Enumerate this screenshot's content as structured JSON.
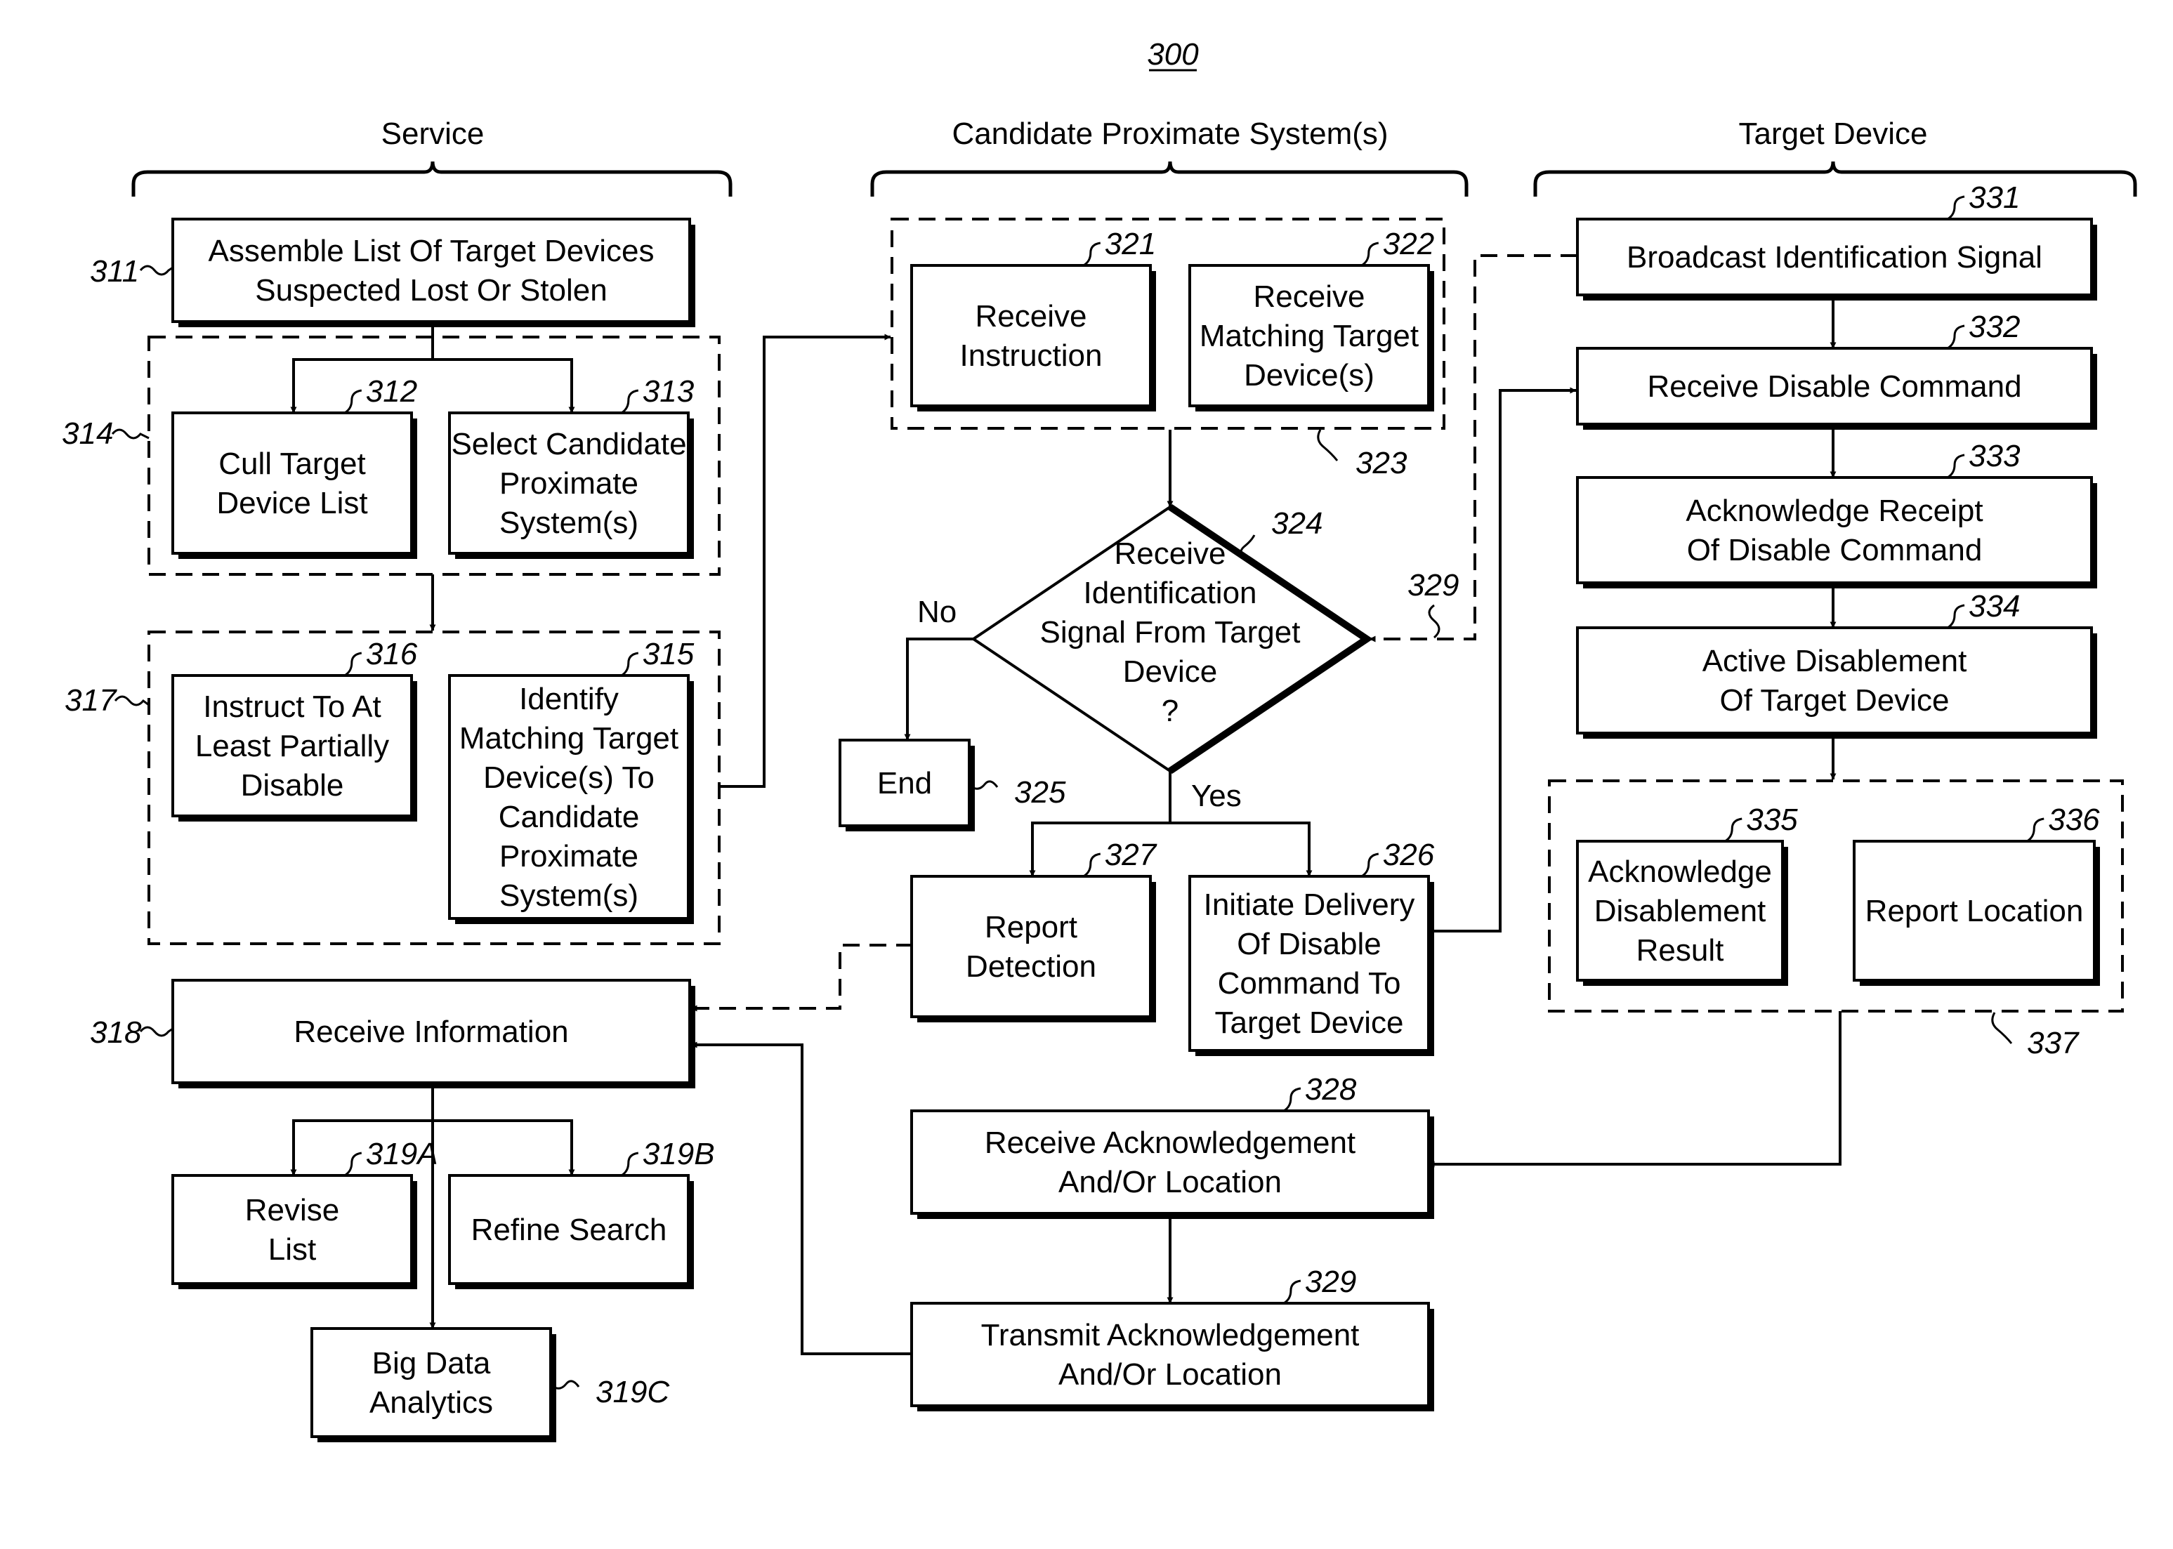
{
  "figure": {
    "number": "300"
  },
  "lanes": [
    {
      "id": "service",
      "title": "Service"
    },
    {
      "id": "candidate",
      "title": "Candidate Proximate System(s)"
    },
    {
      "id": "target",
      "title": "Target Device"
    }
  ],
  "nodes": {
    "n311": {
      "ref": "311",
      "lines": [
        "Assemble List Of Target Devices",
        "Suspected Lost Or Stolen"
      ]
    },
    "n312": {
      "ref": "312",
      "lines": [
        "Cull Target",
        "Device List"
      ]
    },
    "n313": {
      "ref": "313",
      "lines": [
        "Select Candidate",
        "Proximate",
        "System(s)"
      ]
    },
    "g314": {
      "ref": "314"
    },
    "n315": {
      "ref": "315",
      "lines": [
        "Identify",
        "Matching Target",
        "Device(s) To",
        "Candidate",
        "Proximate",
        "System(s)"
      ]
    },
    "n316": {
      "ref": "316",
      "lines": [
        "Instruct To At",
        "Least Partially",
        "Disable"
      ]
    },
    "g317": {
      "ref": "317"
    },
    "n318": {
      "ref": "318",
      "lines": [
        "Receive Information"
      ]
    },
    "n319A": {
      "ref": "319A",
      "lines": [
        "Revise",
        "List"
      ]
    },
    "n319B": {
      "ref": "319B",
      "lines": [
        "Refine Search"
      ]
    },
    "n319C": {
      "ref": "319C",
      "lines": [
        "Big Data",
        "Analytics"
      ]
    },
    "n321": {
      "ref": "321",
      "lines": [
        "Receive",
        "Instruction"
      ]
    },
    "n322": {
      "ref": "322",
      "lines": [
        "Receive",
        "Matching Target",
        "Device(s)"
      ]
    },
    "g323": {
      "ref": "323"
    },
    "n324": {
      "ref": "324",
      "lines": [
        "Receive",
        "Identification",
        "Signal From Target",
        "Device",
        "?"
      ]
    },
    "n325": {
      "ref": "325",
      "lines": [
        "End"
      ]
    },
    "n326": {
      "ref": "326",
      "lines": [
        "Initiate Delivery",
        "Of Disable",
        "Command To",
        "Target Device"
      ]
    },
    "n327": {
      "ref": "327",
      "lines": [
        "Report",
        "Detection"
      ]
    },
    "n328": {
      "ref": "328",
      "lines": [
        "Receive Acknowledgement",
        "And/Or Location"
      ]
    },
    "n329": {
      "ref": "329",
      "lines": [
        "Transmit Acknowledgement",
        "And/Or Location"
      ]
    },
    "e329": {
      "ref": "329"
    },
    "n331": {
      "ref": "331",
      "lines": [
        "Broadcast Identification Signal"
      ]
    },
    "n332": {
      "ref": "332",
      "lines": [
        "Receive Disable Command"
      ]
    },
    "n333": {
      "ref": "333",
      "lines": [
        "Acknowledge Receipt",
        "Of Disable Command"
      ]
    },
    "n334": {
      "ref": "334",
      "lines": [
        "Active Disablement",
        "Of Target Device"
      ]
    },
    "n335": {
      "ref": "335",
      "lines": [
        "Acknowledge",
        "Disablement",
        "Result"
      ]
    },
    "n336": {
      "ref": "336",
      "lines": [
        "Report Location"
      ]
    },
    "g337": {
      "ref": "337"
    }
  },
  "decision_labels": {
    "no": "No",
    "yes": "Yes"
  }
}
